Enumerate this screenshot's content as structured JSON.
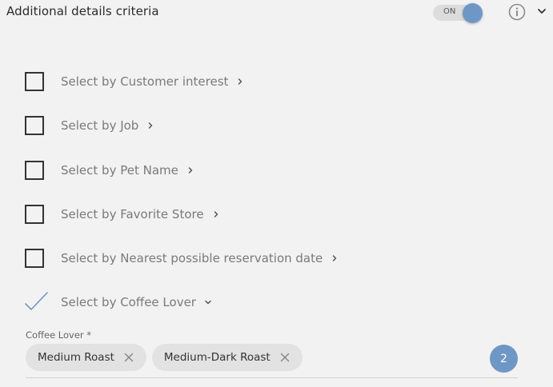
{
  "header": {
    "title": "Additional details criteria",
    "toggle_label": "ON",
    "toggle_state": "on",
    "accent_color": "#6f97c6"
  },
  "options": [
    {
      "label": "Select by Customer interest",
      "checked": false,
      "arrow": "right"
    },
    {
      "label": "Select by Job",
      "checked": false,
      "arrow": "right"
    },
    {
      "label": "Select by Pet Name",
      "checked": false,
      "arrow": "right"
    },
    {
      "label": "Select by Favorite Store",
      "checked": false,
      "arrow": "right"
    },
    {
      "label": "Select by Nearest possible reservation date",
      "checked": false,
      "arrow": "right"
    },
    {
      "label": "Select by Coffee Lover",
      "checked": true,
      "arrow": "down"
    }
  ],
  "coffee_field": {
    "label": "Coffee Lover *",
    "chips": [
      "Medium Roast",
      "Medium-Dark Roast"
    ],
    "count": "2"
  },
  "icons": [
    "info-icon",
    "chevron-down-icon",
    "chevron-right-icon",
    "check-icon",
    "close-icon"
  ]
}
